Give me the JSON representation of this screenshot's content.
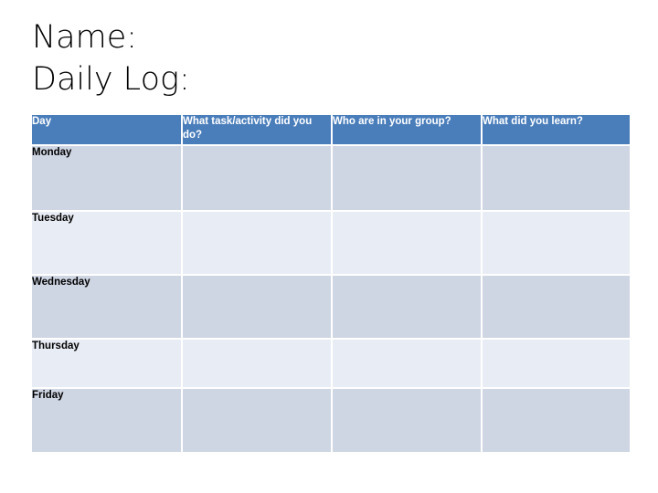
{
  "slide": {
    "title_lines": [
      "Name:",
      "Daily Log:"
    ]
  },
  "colors": {
    "header_blue": "#4a7ebb",
    "row_band_dark": "#ced5e3",
    "row_band_light": "#e8ecf4",
    "header_text": "#ffffff",
    "body_text": "#000000",
    "page_background": "#ffffff"
  },
  "table": {
    "columns": [
      {
        "key": "day",
        "header": "Day"
      },
      {
        "key": "task",
        "header": "What task/activity did you do?"
      },
      {
        "key": "group",
        "header": "Who are in your group?"
      },
      {
        "key": "learn",
        "header": "What did you learn?"
      }
    ],
    "rows": [
      {
        "day": "Monday",
        "task": "",
        "group": "",
        "learn": ""
      },
      {
        "day": "Tuesday",
        "task": "",
        "group": "",
        "learn": ""
      },
      {
        "day": "Wednesday",
        "task": "",
        "group": "",
        "learn": ""
      },
      {
        "day": "Thursday",
        "task": "",
        "group": "",
        "learn": ""
      },
      {
        "day": "Friday",
        "task": "",
        "group": "",
        "learn": ""
      }
    ]
  }
}
